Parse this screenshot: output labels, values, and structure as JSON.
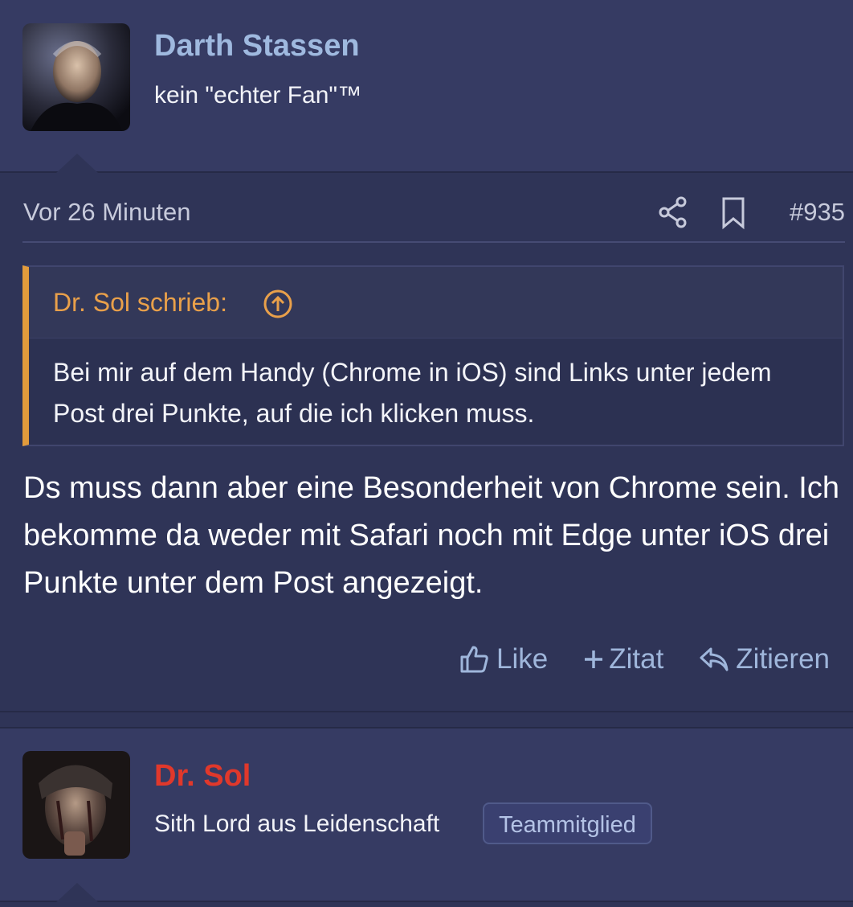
{
  "post1": {
    "username": "Darth Stassen",
    "user_title": "kein \"echter Fan\"™",
    "time": "Vor 26 Minuten",
    "post_number": "#935",
    "quote": {
      "author": "Dr. Sol schrieb:",
      "text": "Bei mir auf dem Handy (Chrome in iOS) sind Links unter jedem Post drei Punkte, auf die ich klicken muss."
    },
    "body": "Ds muss dann aber eine Besonderheit von Chrome sein. Ich bekomme da weder mit Safari noch mit Edge unter iOS drei Punkte unter dem Post angezeigt.",
    "actions": {
      "like": "Like",
      "zitat": "Zitat",
      "zitieren": "Zitieren"
    }
  },
  "post2": {
    "username": "Dr. Sol",
    "user_title": "Sith Lord aus Leidenschaft",
    "badge": "Teammitglied"
  },
  "colors": {
    "username1": "#9fb9df",
    "username2": "#e0382b",
    "quote_accent": "#e29b3c",
    "action": "#9fb6db"
  },
  "icons": [
    "share-icon",
    "bookmark-icon",
    "arrow-up-circle-icon",
    "thumbs-up-icon",
    "plus-icon",
    "reply-icon"
  ]
}
